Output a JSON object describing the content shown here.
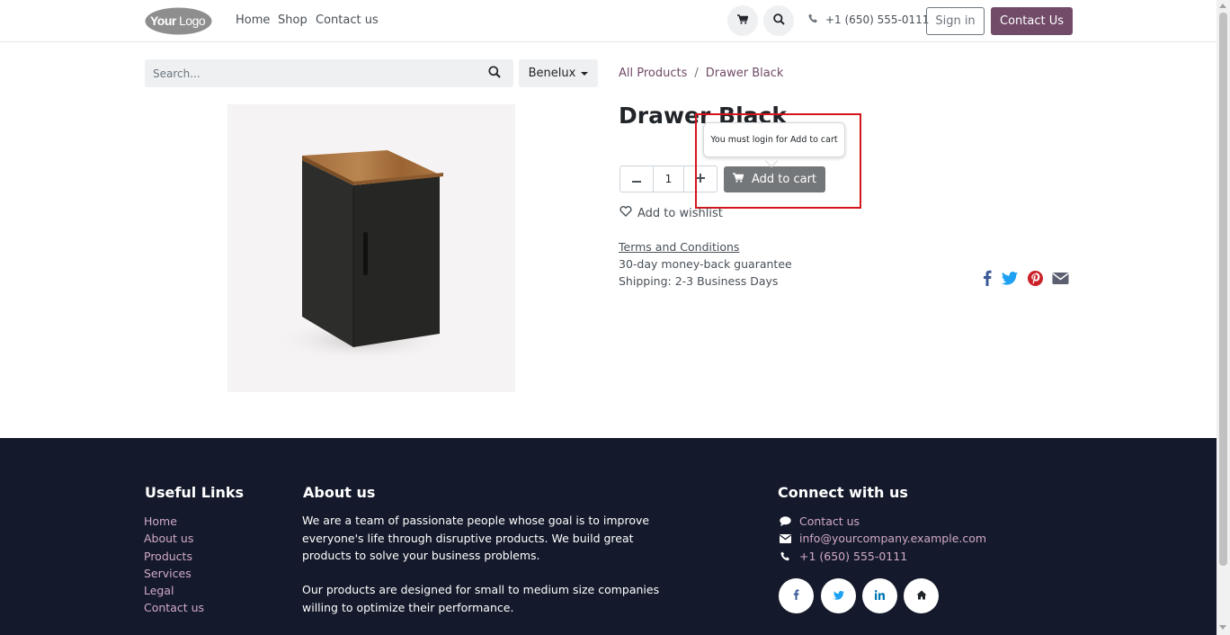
{
  "header": {
    "logo_text": "YourLogo",
    "nav": [
      "Home",
      "Shop",
      "Contact us"
    ],
    "phone": "+1 (650) 555-0111",
    "sign_in": "Sign in",
    "contact_us": "Contact Us"
  },
  "search": {
    "placeholder": "Search..."
  },
  "pricelist": {
    "selected": "Benelux"
  },
  "breadcrumb": {
    "parent": "All Products",
    "separator": "/",
    "current": "Drawer Black"
  },
  "product": {
    "title": "Drawer Black",
    "quantity": "1",
    "add_to_cart": "Add to cart",
    "tooltip": "You must login for Add to cart",
    "wishlist": "Add to wishlist",
    "terms": "Terms and Conditions",
    "guarantee": "30-day money-back guarantee",
    "shipping": "Shipping: 2-3 Business Days"
  },
  "footer": {
    "useful_links": {
      "heading": "Useful Links",
      "items": [
        "Home",
        "About us",
        "Products",
        "Services",
        "Legal",
        "Contact us"
      ]
    },
    "about": {
      "heading": "About us",
      "para1": "We are a team of passionate people whose goal is to improve everyone's life through disruptive products. We build great products to solve your business problems.",
      "para2": "Our products are designed for small to medium size companies willing to optimize their performance."
    },
    "connect": {
      "heading": "Connect with us",
      "contact": "Contact us",
      "email": "info@yourcompany.example.com",
      "phone": "+1 (650) 555-0111"
    }
  },
  "colors": {
    "brand": "#714b67",
    "footer_bg": "#141a2b",
    "footer_link": "#d1a8c8",
    "highlight": "#d4161c"
  }
}
